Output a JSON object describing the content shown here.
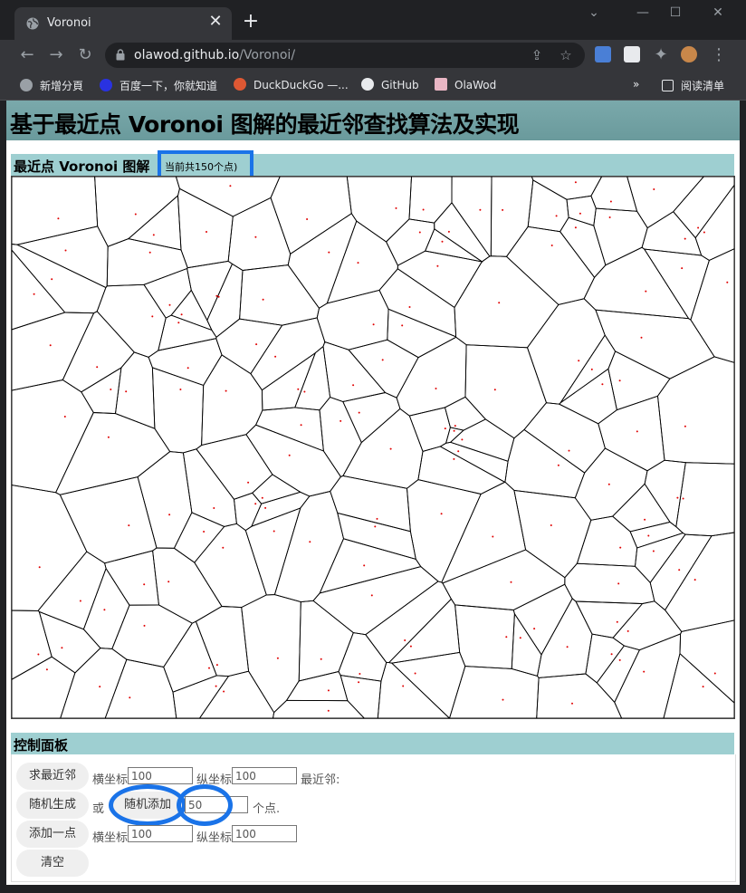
{
  "browser": {
    "tab_title": "Voronoi",
    "url_host": "olawod.github.io",
    "url_path": "/Voronoi/",
    "bookmarks": [
      {
        "label": "新增分頁",
        "color": "#9aa0a6"
      },
      {
        "label": "百度一下，你就知道",
        "color": "#2932e1"
      },
      {
        "label": "DuckDuckGo —...",
        "color": "#de5833"
      },
      {
        "label": "GitHub",
        "color": "#e8eaed"
      },
      {
        "label": "OlaWod",
        "color": "#e9b6c4"
      }
    ],
    "reading_list": "阅读清单"
  },
  "page": {
    "title": "基于最近点 Voronoi 图解的最近邻查找算法及实现",
    "diagram_section": "最近点 Voronoi 图解",
    "point_count_text": "当前共150个点)",
    "control_section": "控制面板"
  },
  "controls": {
    "nearest_button": "求最近邻",
    "x_label": "横坐标",
    "x_value": "100",
    "y_label": "纵坐标",
    "y_value": "100",
    "nearest_result_label": "最近邻:",
    "random_generate_button": "随机生成",
    "or_text": "或",
    "random_add_button": "随机添加",
    "random_count": "50",
    "points_suffix": "个点.",
    "add_point_button": "添加一点",
    "add_x_label": "横坐标",
    "add_x_value": "100",
    "add_y_label": "纵坐标",
    "add_y_value": "100",
    "clear_button": "清空"
  },
  "colors": {
    "accent_highlight": "#1a73e8",
    "title_bar": "#6a9a9c",
    "section_bar": "#9ecfd1",
    "site_point": "#e00000",
    "cell_edge": "#000000"
  }
}
